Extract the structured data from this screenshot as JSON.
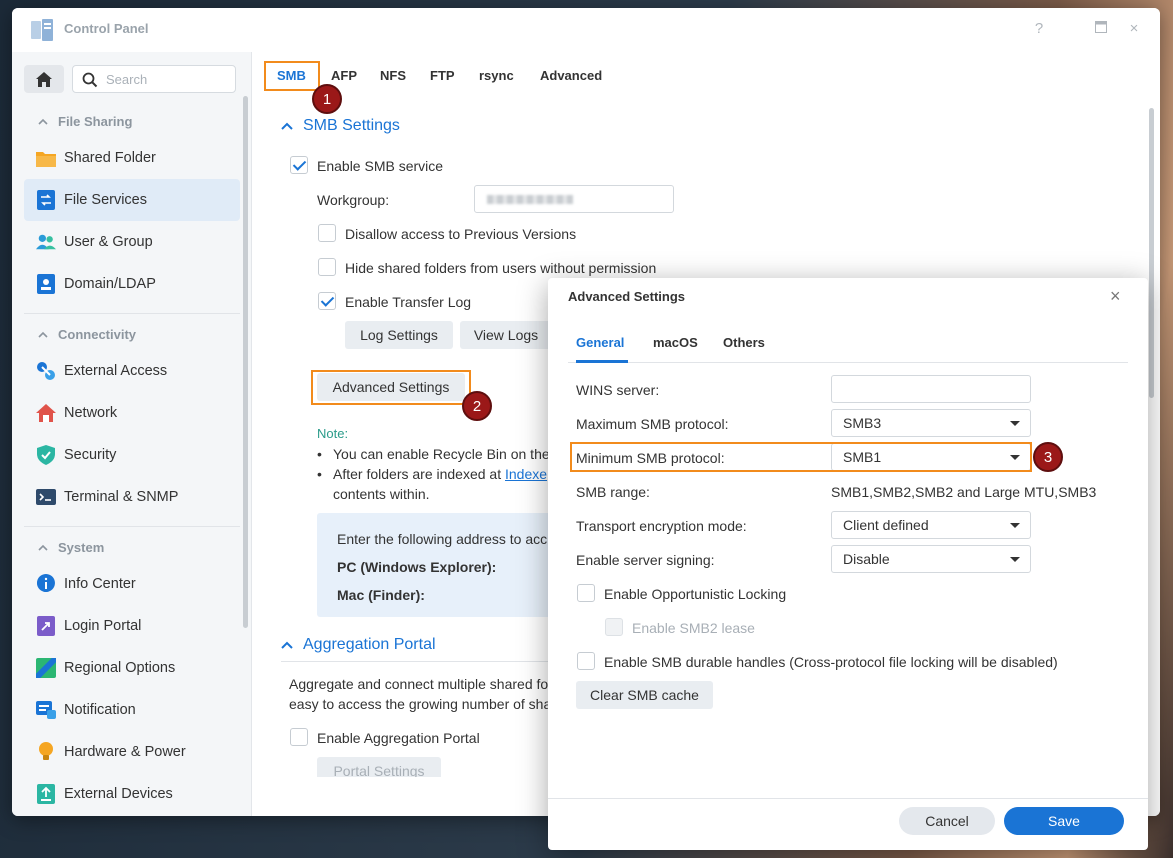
{
  "window": {
    "title": "Control Panel",
    "help": "?",
    "maximize": "□",
    "close": "×"
  },
  "sidebar": {
    "search_placeholder": "Search",
    "groups": [
      {
        "label": "File Sharing"
      },
      {
        "label": "Connectivity"
      },
      {
        "label": "System"
      }
    ],
    "items": [
      {
        "label": "Shared Folder",
        "icon": "folder-icon"
      },
      {
        "label": "File Services",
        "icon": "file-services-icon",
        "active": true
      },
      {
        "label": "User & Group",
        "icon": "users-icon"
      },
      {
        "label": "Domain/LDAP",
        "icon": "domain-icon"
      },
      {
        "label": "External Access",
        "icon": "external-access-icon"
      },
      {
        "label": "Network",
        "icon": "network-icon"
      },
      {
        "label": "Security",
        "icon": "shield-icon"
      },
      {
        "label": "Terminal & SNMP",
        "icon": "terminal-icon"
      },
      {
        "label": "Info Center",
        "icon": "info-icon"
      },
      {
        "label": "Login Portal",
        "icon": "login-portal-icon"
      },
      {
        "label": "Regional Options",
        "icon": "regional-icon"
      },
      {
        "label": "Notification",
        "icon": "notification-icon"
      },
      {
        "label": "Hardware & Power",
        "icon": "bulb-icon"
      },
      {
        "label": "External Devices",
        "icon": "external-devices-icon"
      }
    ]
  },
  "tabs": [
    "SMB",
    "AFP",
    "NFS",
    "FTP",
    "rsync",
    "Advanced"
  ],
  "badges": [
    "1",
    "2",
    "3"
  ],
  "smb": {
    "section_title": "SMB Settings",
    "enable_service": "Enable SMB service",
    "workgroup_label": "Workgroup:",
    "disallow_prev": "Disallow access to Previous Versions",
    "hide_shared": "Hide shared folders from users without permission",
    "enable_transfer_log": "Enable Transfer Log",
    "log_settings": "Log Settings",
    "view_logs": "View Logs",
    "advanced_settings": "Advanced Settings",
    "note_title": "Note:",
    "note_line1": "You can enable Recycle Bin on the",
    "note_line2_prefix": "After folders are indexed at ",
    "note_line2_link": "Indexe",
    "note_line3": "contents within.",
    "addr_intro": "Enter the following address to acc",
    "pc_label": "PC (Windows Explorer):",
    "mac_label": "Mac (Finder):"
  },
  "aggregation": {
    "section_title": "Aggregation Portal",
    "desc_line1": "Aggregate and connect multiple shared fo",
    "desc_line2": "easy to access the growing number of sha",
    "enable": "Enable Aggregation Portal",
    "portal_settings": "Portal Settings"
  },
  "dialog": {
    "title": "Advanced Settings",
    "close": "×",
    "tabs": [
      "General",
      "macOS",
      "Others"
    ],
    "wins_label": "WINS server:",
    "wins_value": "",
    "max_label": "Maximum SMB protocol:",
    "max_value": "SMB3",
    "min_label": "Minimum SMB protocol:",
    "min_value": "SMB1",
    "range_label": "SMB range:",
    "range_value": "SMB1,SMB2,SMB2 and Large MTU,SMB3",
    "transport_label": "Transport encryption mode:",
    "transport_value": "Client defined",
    "signing_label": "Enable server signing:",
    "signing_value": "Disable",
    "oplock": "Enable Opportunistic Locking",
    "smb2_lease": "Enable SMB2 lease",
    "durable": "Enable SMB durable handles (Cross-protocol file locking will be disabled)",
    "clear_cache": "Clear SMB cache",
    "cancel": "Cancel",
    "save": "Save"
  },
  "colors": {
    "accent": "#1a74d5",
    "highlight": "#f28b1c",
    "badge": "#9b1818"
  }
}
